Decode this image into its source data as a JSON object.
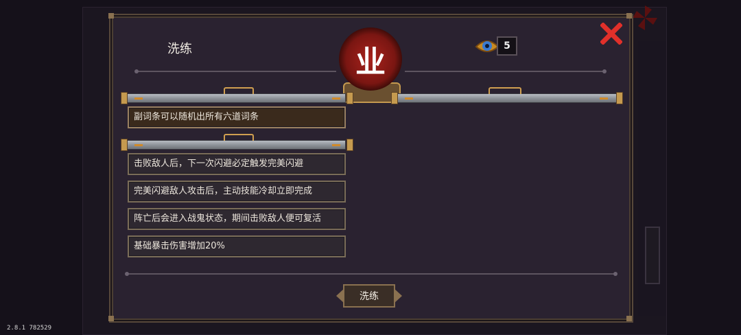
{
  "window": {
    "title": "洗练",
    "version_text": "2.8.1 782529"
  },
  "currency": {
    "icon": "eye-gem-icon",
    "count": "5"
  },
  "emblem": {
    "glyph": "业"
  },
  "primary_affix": {
    "text": "副词条可以随机出所有六道词条"
  },
  "secondary_affixes": [
    {
      "text": "击败敌人后，下一次闪避必定触发完美闪避"
    },
    {
      "text": "完美闪避敌人攻击后，主动技能冷却立即完成"
    },
    {
      "text": "阵亡后会进入战鬼状态，期间击败敌人便可复活"
    },
    {
      "text": "基础暴击伤害增加20%"
    }
  ],
  "actions": {
    "refine_label": "洗练"
  },
  "colors": {
    "panel_bg": "#2a2230",
    "border_gold": "#8a7150",
    "close_red": "#e0302a",
    "emblem_red": "#a8221c"
  }
}
